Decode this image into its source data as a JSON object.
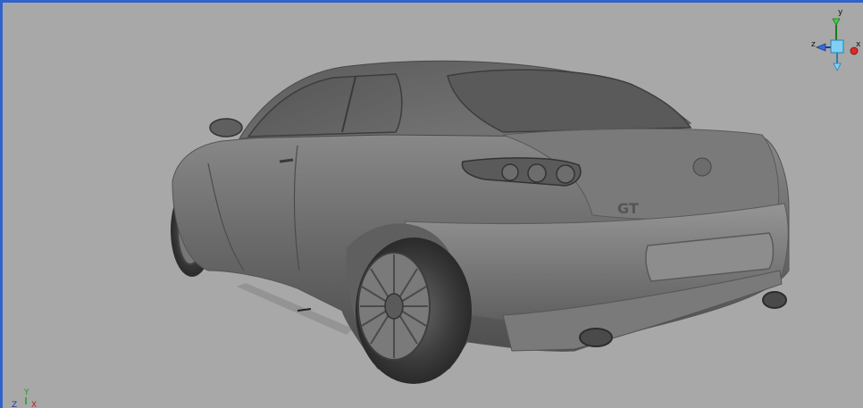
{
  "viewport": {
    "background_color": "#a8a8a8",
    "border_color": "#2f63c9",
    "model_color": "#6e6e6e",
    "badge_text": "GT"
  },
  "view_cube": {
    "axis_y_label": "y",
    "axis_z_label": "z",
    "axis_x_label": "x",
    "icon": "view-cube-icon",
    "color_y": "#3ad23a",
    "color_z": "#3a6ae0",
    "color_x": "#e02a2a",
    "color_cube": "#7fd0f5"
  },
  "mini_axis": {
    "icon": "axis-tripod-icon",
    "label_y": "Y",
    "label_z": "Z",
    "label_x": "X"
  }
}
